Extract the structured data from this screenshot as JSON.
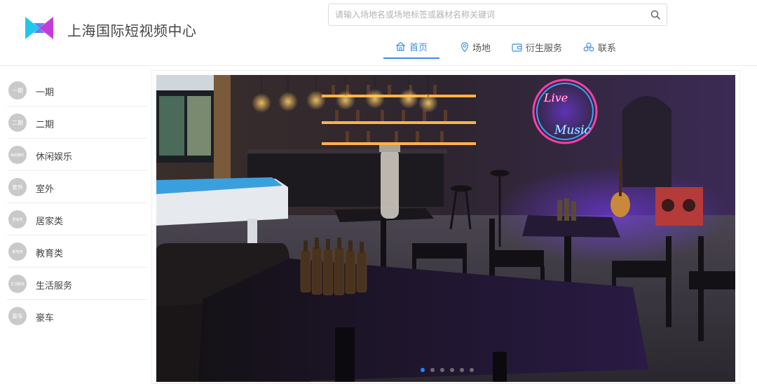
{
  "header": {
    "site_title": "上海国际短视频中心",
    "logo_colors": {
      "cyan": "#21c7e8",
      "blue": "#3e6df0",
      "magenta": "#c63bd8"
    }
  },
  "search": {
    "placeholder": "请输入场地名或场地标签或器材名称关键词",
    "value": "",
    "icon": "search-icon"
  },
  "nav": {
    "items": [
      {
        "label": "首页",
        "icon": "home-icon",
        "active": true
      },
      {
        "label": "场地",
        "icon": "location-pin-icon",
        "active": false
      },
      {
        "label": "衍生服务",
        "icon": "wallet-icon",
        "active": false
      },
      {
        "label": "联系",
        "icon": "contact-icon",
        "active": false
      }
    ],
    "accent": "#3a8ee6"
  },
  "sidebar": {
    "items": [
      {
        "badge": "一期",
        "label": "一期"
      },
      {
        "badge": "二期",
        "label": "二期"
      },
      {
        "badge": "休闲娱乐",
        "label": "休闲娱乐"
      },
      {
        "badge": "室外",
        "label": "室外"
      },
      {
        "badge": "居家类",
        "label": "居家类"
      },
      {
        "badge": "教育类",
        "label": "教育类"
      },
      {
        "badge": "生活服务",
        "label": "生活服务"
      },
      {
        "badge": "豪车",
        "label": "豪车"
      }
    ]
  },
  "banner": {
    "neon_text": [
      "Live",
      "Music"
    ],
    "slide_count": 6,
    "active_slide": 1
  }
}
